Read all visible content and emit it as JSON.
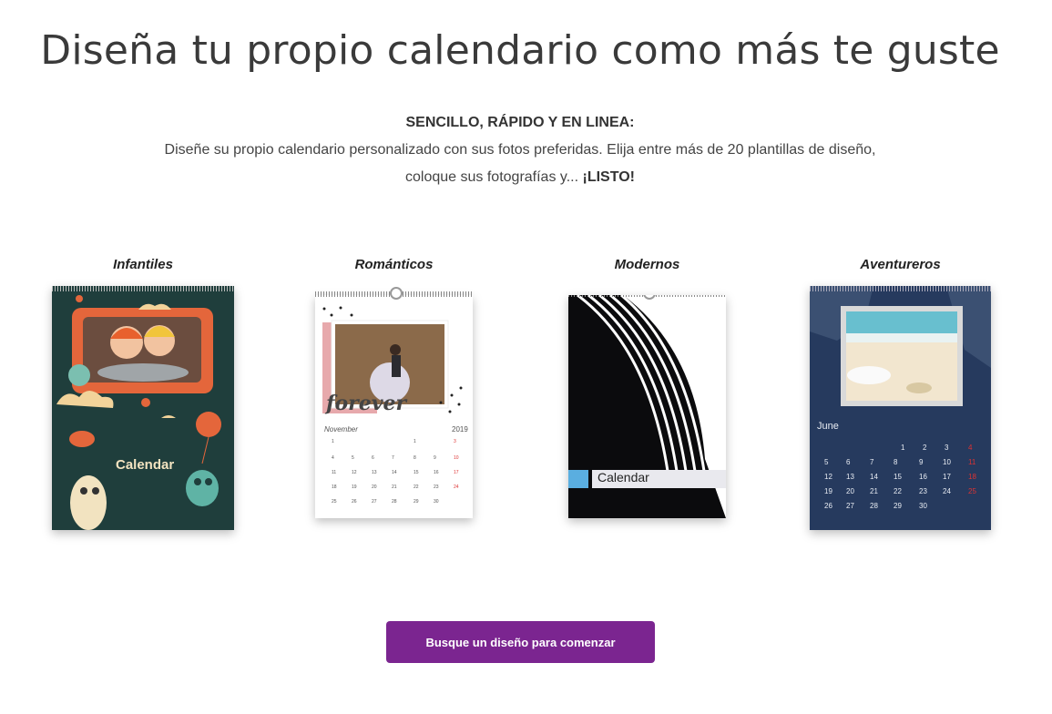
{
  "header": {
    "title": "Diseña tu propio calendario como más te guste",
    "subtitle": "SENCILLO, RÁPIDO Y EN LINEA:",
    "description": "Diseñe su propio calendario personalizado con sus fotos preferidas. Elija entre más de 20 plantillas de diseño, coloque sus fotografías y...",
    "description_emphasis": "¡LISTO!"
  },
  "categories": [
    {
      "label": "Infantiles",
      "cover_text": "Calendar"
    },
    {
      "label": "Románticos",
      "cover_text": "forever",
      "month": "November",
      "year": "2019"
    },
    {
      "label": "Modernos",
      "cover_text": "Calendar"
    },
    {
      "label": "Aventureros",
      "month": "June"
    }
  ],
  "cta": {
    "label": "Busque un diseño para comenzar"
  },
  "colors": {
    "accent": "#7b2590",
    "kids_bg": "#1f3e3c",
    "adventure_bg": "#263a5e",
    "modern_accent": "#5aaee0"
  }
}
